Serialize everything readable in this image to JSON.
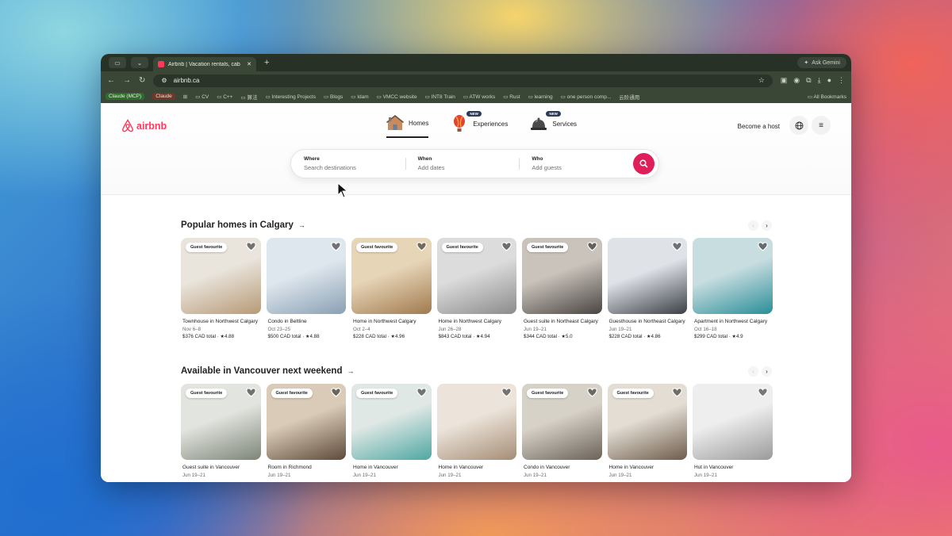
{
  "browser": {
    "tab_title": "Airbnb | Vacation rentals, cab",
    "url": "airbnb.ca",
    "gemini_label": "Ask Gemini",
    "bookmarks": [
      "Claude (MCP)",
      "Claude",
      "CV",
      "C++",
      "算法",
      "Interesting Projects",
      "Blogs",
      "Idam",
      "VMCC website",
      "INT8 Train",
      "ATW works",
      "Rust",
      "learning",
      "one person comp...",
      "云阶通用"
    ],
    "all_bookmarks": "All Bookmarks"
  },
  "header": {
    "logo_text": "airbnb",
    "nav": [
      {
        "label": "Homes",
        "icon": "house-icon",
        "badge": ""
      },
      {
        "label": "Experiences",
        "icon": "balloon-icon",
        "badge": "NEW"
      },
      {
        "label": "Services",
        "icon": "service-bell-icon",
        "badge": "NEW"
      }
    ],
    "become_host": "Become a host"
  },
  "search": {
    "where_label": "Where",
    "where_placeholder": "Search destinations",
    "when_label": "When",
    "when_placeholder": "Add dates",
    "who_label": "Who",
    "who_placeholder": "Add guests"
  },
  "sections": [
    {
      "title": "Popular homes in Calgary",
      "cards": [
        {
          "title": "Townhouse in Northwest Calgary",
          "dates": "Nov 6–8",
          "price": "$376 CAD total",
          "rating": "★4.88",
          "guest_fav": "Guest favourite",
          "c1": "#e9e4dc",
          "c2": "#b79a76"
        },
        {
          "title": "Condo in Beltline",
          "dates": "Oct 23–25",
          "price": "$500 CAD total",
          "rating": "★4.88",
          "guest_fav": "",
          "c1": "#dfe7ee",
          "c2": "#8aa0b4"
        },
        {
          "title": "Home in Northwest Calgary",
          "dates": "Oct 2–4",
          "price": "$228 CAD total",
          "rating": "★4.96",
          "guest_fav": "Guest favourite",
          "c1": "#e7d5b8",
          "c2": "#a07a4e"
        },
        {
          "title": "Home in Northwest Calgary",
          "dates": "Jun 26–28",
          "price": "$843 CAD total",
          "rating": "★4.94",
          "guest_fav": "Guest favourite",
          "c1": "#dcdcdc",
          "c2": "#8b8b8b"
        },
        {
          "title": "Guest suite in Northeast Calgary",
          "dates": "Jun 19–21",
          "price": "$344 CAD total",
          "rating": "★5.0",
          "guest_fav": "Guest favourite",
          "c1": "#c9c3bb",
          "c2": "#4a4542"
        },
        {
          "title": "Guesthouse in Northeast Calgary",
          "dates": "Jun 19–21",
          "price": "$228 CAD total",
          "rating": "★4.86",
          "guest_fav": "",
          "c1": "#dfe3e8",
          "c2": "#3b3f46"
        },
        {
          "title": "Apartment in Northwest Calgary",
          "dates": "Oct 16–18",
          "price": "$299 CAD total",
          "rating": "★4.9",
          "guest_fav": "",
          "c1": "#c8dde0",
          "c2": "#2a8e98"
        }
      ]
    },
    {
      "title": "Available in Vancouver next weekend",
      "cards": [
        {
          "title": "Guest suite in Vancouver",
          "dates": "Jun 19–21",
          "price": "",
          "rating": "",
          "guest_fav": "Guest favourite",
          "c1": "#e2e4df",
          "c2": "#7d8577"
        },
        {
          "title": "Room in Richmond",
          "dates": "Jun 19–21",
          "price": "",
          "rating": "",
          "guest_fav": "Guest favourite",
          "c1": "#d9cbb7",
          "c2": "#5e4a3a"
        },
        {
          "title": "Home in Vancouver",
          "dates": "Jun 19–21",
          "price": "",
          "rating": "",
          "guest_fav": "Guest favourite",
          "c1": "#e0e8e5",
          "c2": "#4fa7a2"
        },
        {
          "title": "Home in Vancouver",
          "dates": "Jun 19–21",
          "price": "",
          "rating": "",
          "guest_fav": "",
          "c1": "#ece4da",
          "c2": "#a58d76"
        },
        {
          "title": "Condo in Vancouver",
          "dates": "Jun 19–21",
          "price": "",
          "rating": "",
          "guest_fav": "Guest favourite",
          "c1": "#d7d2c8",
          "c2": "#6b6258"
        },
        {
          "title": "Home in Vancouver",
          "dates": "Jun 19–21",
          "price": "",
          "rating": "",
          "guest_fav": "Guest favourite",
          "c1": "#e3ddd4",
          "c2": "#6e5c4b"
        },
        {
          "title": "Hut in Vancouver",
          "dates": "Jun 19–21",
          "price": "",
          "rating": "",
          "guest_fav": "",
          "c1": "#eeeeee",
          "c2": "#9a9a9a"
        }
      ]
    }
  ],
  "colors": {
    "brand": "#ff385c",
    "search_button": "#e01e5a"
  }
}
